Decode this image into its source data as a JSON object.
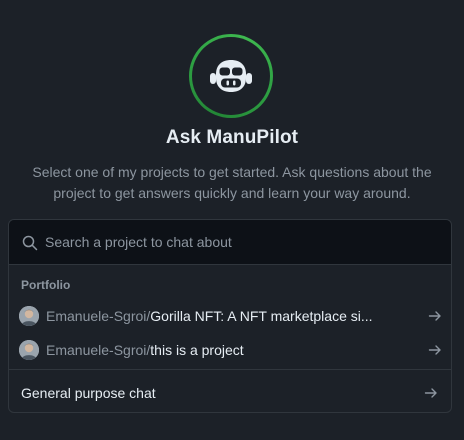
{
  "hero": {
    "title": "Ask ManuPilot",
    "subtitle": "Select one of my projects to get started. Ask questions about the project to get answers quickly and learn your way around.",
    "logo_icon": "copilot-icon"
  },
  "search": {
    "placeholder": "Search a project to chat about",
    "value": "",
    "icon": "search-icon"
  },
  "projects": {
    "group_label": "Portfolio",
    "items": [
      {
        "owner": "Emanuele-Sgroi/",
        "repo": "Gorilla NFT: A NFT marketplace si...",
        "icon": "arrow-right-icon"
      },
      {
        "owner": "Emanuele-Sgroi/",
        "repo": "this is a project",
        "icon": "arrow-right-icon"
      }
    ]
  },
  "general": {
    "label": "General purpose chat",
    "icon": "arrow-right-icon"
  },
  "colors": {
    "background": "#1c2128",
    "search_background": "#0d1117",
    "border": "#30363d",
    "text_primary": "#e6edf3",
    "text_muted": "#8d96a0",
    "accent_green": "#2ea043"
  }
}
